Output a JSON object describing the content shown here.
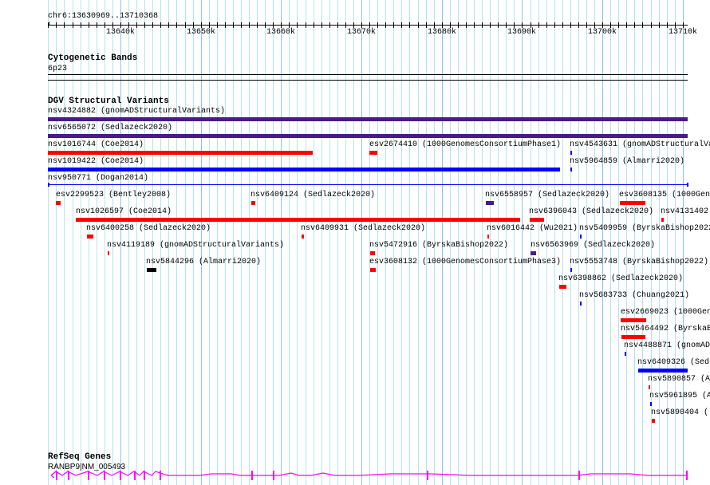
{
  "ruler": {
    "location": "chr6:13630969..13710368",
    "ticks": [
      "13640k",
      "13650k",
      "13660k",
      "13670k",
      "13680k",
      "13690k",
      "13700k",
      "13710k"
    ]
  },
  "cytobands": {
    "title": "Cytogenetic Bands",
    "band": "6p23"
  },
  "dgv": {
    "title": "DGV Structural Variants",
    "features": [
      {
        "label": "nsv4324882 (gnomADStructuralVariants)",
        "color": "#4b1a86"
      },
      {
        "label": "nsv6565072 (Sedlazeck2020)",
        "color": "#4b1a86"
      },
      {
        "label": "nsv1016744 (Coe2014)",
        "color": "#ff0000"
      },
      {
        "label": "esv2674410 (1000GenomesConsortiumPhase1)",
        "color": "#ff0000"
      },
      {
        "label": "nsv4543631 (gnomADStructuralVa",
        "color": "#0000ff"
      },
      {
        "label": "nsv1019422 (Coe2014)",
        "color": "#0000ff"
      },
      {
        "label": "nsv5964859 (Almarri2020)",
        "color": "#0000ff"
      },
      {
        "label": "nsv950771 (Dogan2014)",
        "color": "#0000ff"
      },
      {
        "label": "esv2299523 (Bentley2008)",
        "color": "#ff0000"
      },
      {
        "label": "nsv6409124 (Sedlazeck2020)",
        "color": "#ff0000"
      },
      {
        "label": "nsv6558957 (Sedlazeck2020)",
        "color": "#4b1a86"
      },
      {
        "label": "esv3608135 (1000Gen",
        "color": "#ff0000"
      },
      {
        "label": "nsv1026597 (Coe2014)",
        "color": "#ff0000"
      },
      {
        "label": "nsv6396043 (Sedlazeck2020)",
        "color": "#ff0000"
      },
      {
        "label": "nsv4131402",
        "color": "#ff0000"
      },
      {
        "label": "nsv6400258 (Sedlazeck2020)",
        "color": "#ff0000"
      },
      {
        "label": "nsv6409931 (Sedlazeck2020)",
        "color": "#ff0000"
      },
      {
        "label": "nsv6016442 (Wu2021)",
        "color": "#ff0000"
      },
      {
        "label": "nsv5409959 (ByrskaBishop2022",
        "color": "#0000ff"
      },
      {
        "label": "nsv4119189 (gnomADStructuralVariants)",
        "color": "#ff0000"
      },
      {
        "label": "nsv5472916 (ByrskaBishop2022)",
        "color": "#ff0000"
      },
      {
        "label": "nsv6563969 (Sedlazeck2020)",
        "color": "#4b1a86"
      },
      {
        "label": "nsv5844296 (Almarri2020)",
        "color": "#000000"
      },
      {
        "label": "esv3608132 (1000GenomesConsortiumPhase3)",
        "color": "#ff0000"
      },
      {
        "label": "nsv5553748 (ByrskaBishop2022)",
        "color": "#0000ff"
      },
      {
        "label": "nsv6398862 (Sedlazeck2020)",
        "color": "#ff0000"
      },
      {
        "label": "nsv5683733 (Chuang2021)",
        "color": "#0000ff"
      },
      {
        "label": "esv2669023 (1000Gen",
        "color": "#ff0000"
      },
      {
        "label": "nsv5464492 (ByrskaB",
        "color": "#ff0000"
      },
      {
        "label": "nsv4488871 (gnomAD",
        "color": "#0000ff"
      },
      {
        "label": "nsv6409326 (Sed",
        "color": "#0000ff"
      },
      {
        "label": "nsv5890857 (A",
        "color": "#ff0000"
      },
      {
        "label": "nsv5961895 (A",
        "color": "#0000ff"
      },
      {
        "label": "nsv5890404 (",
        "color": "#ff0000"
      }
    ]
  },
  "refseq": {
    "title": "RefSeq Genes",
    "gene": "RANBP9|NM_005493",
    "color": "#ff00ff"
  }
}
